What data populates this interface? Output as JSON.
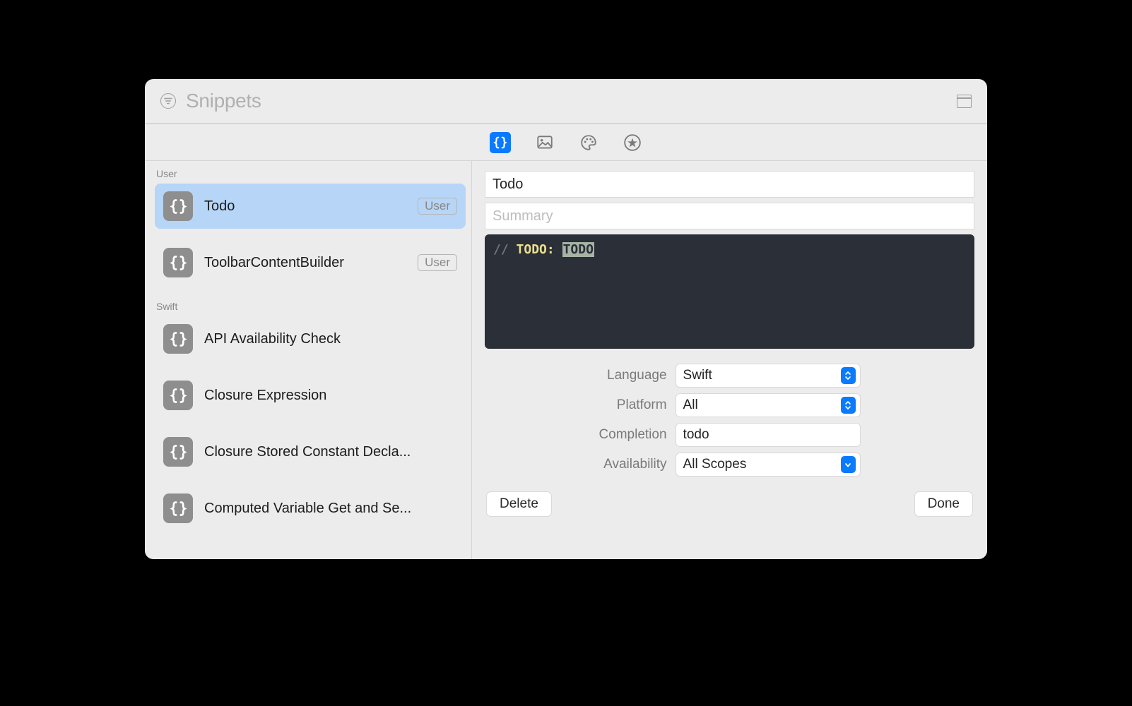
{
  "titlebar": {
    "title": "Snippets"
  },
  "tabbar": {
    "icons": [
      "code-braces-icon",
      "image-icon",
      "palette-icon",
      "star-icon"
    ],
    "active": 0
  },
  "sidebar": {
    "sections": [
      {
        "header": "User",
        "items": [
          {
            "label": "Todo",
            "badge": "User",
            "selected": true
          },
          {
            "label": "ToolbarContentBuilder",
            "badge": "User"
          }
        ]
      },
      {
        "header": "Swift",
        "items": [
          {
            "label": "API Availability Check"
          },
          {
            "label": "Closure Expression"
          },
          {
            "label": "Closure Stored Constant Decla..."
          },
          {
            "label": "Computed Variable Get and Se..."
          }
        ]
      }
    ]
  },
  "editor": {
    "title_value": "Todo",
    "summary_placeholder": "Summary",
    "code": {
      "prefix": "//",
      "tag": "TODO:",
      "placeholder": "TODO"
    },
    "form": {
      "language_label": "Language",
      "language_value": "Swift",
      "platform_label": "Platform",
      "platform_value": "All",
      "completion_label": "Completion",
      "completion_value": "todo",
      "availability_label": "Availability",
      "availability_value": "All Scopes"
    },
    "buttons": {
      "delete": "Delete",
      "done": "Done"
    }
  }
}
